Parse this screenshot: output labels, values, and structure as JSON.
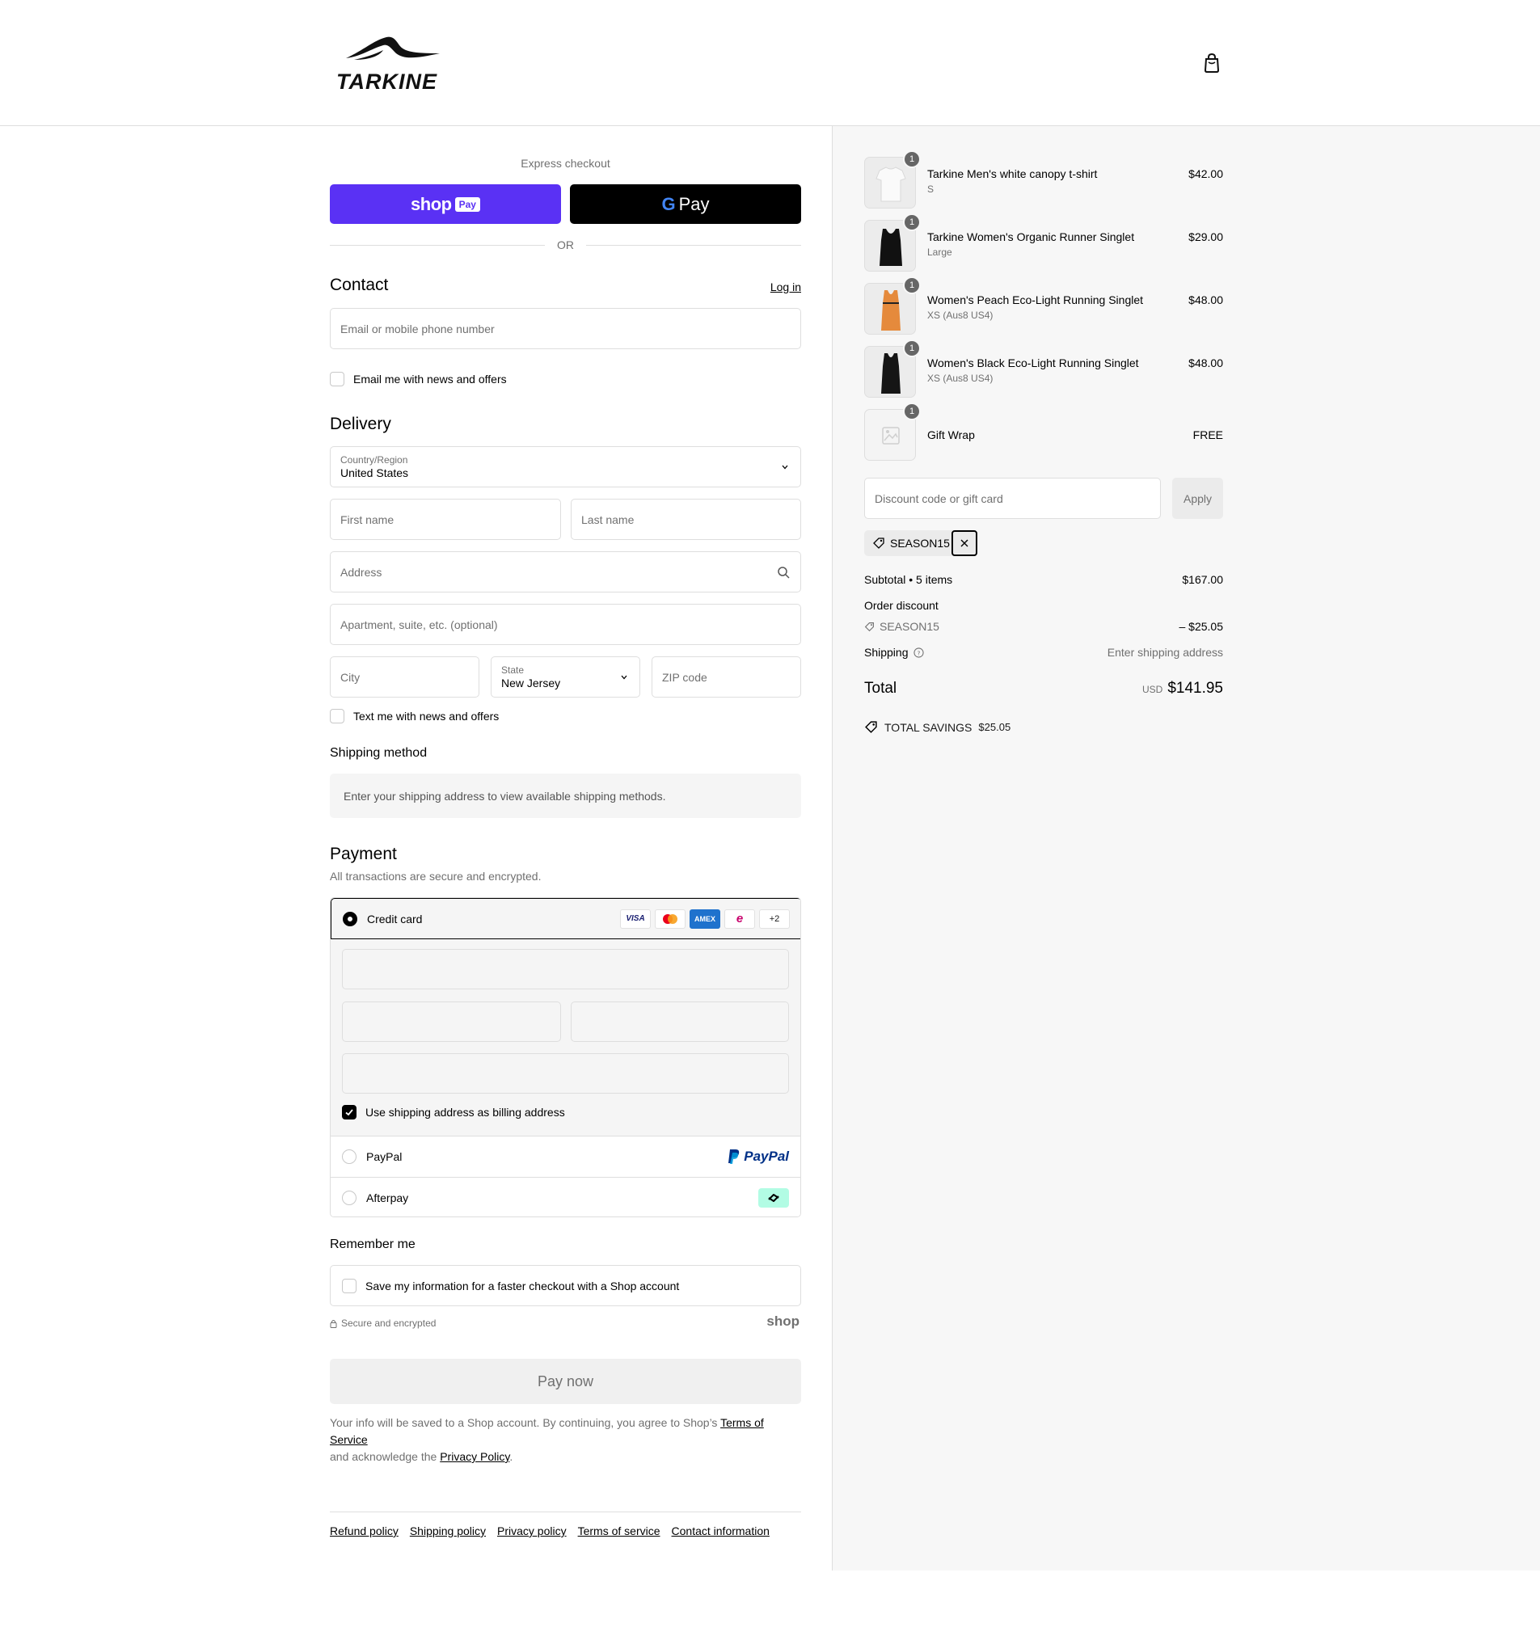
{
  "brand": {
    "name": "TARKINE"
  },
  "header": {
    "cart_icon": "shopping-bag-icon"
  },
  "express": {
    "title": "Express checkout",
    "shop_pay": {
      "word": "shop",
      "chip": "Pay"
    },
    "gpay": {
      "letter": "G",
      "word": "Pay"
    },
    "or": "OR"
  },
  "contact": {
    "title": "Contact",
    "login": "Log in",
    "email_placeholder": "Email or mobile phone number",
    "news_label": "Email me with news and offers"
  },
  "delivery": {
    "title": "Delivery",
    "country_label": "Country/Region",
    "country_value": "United States",
    "first_name": "First name",
    "last_name": "Last name",
    "address": "Address",
    "apartment": "Apartment, suite, etc. (optional)",
    "city": "City",
    "state_label": "State",
    "state_value": "New Jersey",
    "zip": "ZIP code",
    "text_label": "Text me with news and offers"
  },
  "shipping_method": {
    "title": "Shipping method",
    "message": "Enter your shipping address to view available shipping methods."
  },
  "payment": {
    "title": "Payment",
    "subtitle": "All transactions are secure and encrypted.",
    "credit_card": "Credit card",
    "card_brands": [
      "VISA",
      "mastercard",
      "AMEX",
      "elopeo"
    ],
    "more_cards": "+2",
    "billing_label": "Use shipping address as billing address",
    "paypal": "PayPal",
    "paypal_logo": "PayPal",
    "afterpay": "Afterpay"
  },
  "remember": {
    "title": "Remember me",
    "save_label": "Save my information for a faster checkout with a Shop account",
    "secure": "Secure and encrypted",
    "shop_mark": "shop"
  },
  "pay_now": "Pay now",
  "legal": {
    "prefix": "Your info will be saved to a Shop account. By continuing, you agree to Shop’s ",
    "terms": "Terms of Service",
    "middle": "and acknowledge the ",
    "privacy": "Privacy Policy",
    "suffix": "."
  },
  "footer": {
    "links": [
      "Refund policy",
      "Shipping policy",
      "Privacy policy",
      "Terms of service",
      "Contact information"
    ]
  },
  "order": {
    "items": [
      {
        "qty": "1",
        "name": "Tarkine Men's white canopy t-shirt",
        "variant": "S",
        "price": "$42.00",
        "color": "#f2f2f2"
      },
      {
        "qty": "1",
        "name": "Tarkine Women's Organic Runner Singlet",
        "variant": "Large",
        "price": "$29.00",
        "color": "#111111"
      },
      {
        "qty": "1",
        "name": "Women's Peach Eco-Light Running Singlet",
        "variant": "XS (Aus8 US4)",
        "price": "$48.00",
        "color": "#e58a3c"
      },
      {
        "qty": "1",
        "name": "Women's Black Eco-Light Running Singlet",
        "variant": "XS (Aus8 US4)",
        "price": "$48.00",
        "color": "#151515"
      },
      {
        "qty": "1",
        "name": "Gift Wrap",
        "variant": "",
        "price": "FREE",
        "color": "#f4f4f4"
      }
    ],
    "discount_placeholder": "Discount code or gift card",
    "apply": "Apply",
    "applied_code": "SEASON15",
    "subtotal_label": "Subtotal • 5 items",
    "subtotal_value": "$167.00",
    "order_discount_label": "Order discount",
    "discount_code": "SEASON15",
    "discount_value": "– $25.05",
    "shipping_label": "Shipping",
    "shipping_value": "Enter shipping address",
    "total_label": "Total",
    "currency": "USD",
    "total_value": "$141.95",
    "savings_label": "TOTAL SAVINGS",
    "savings_value": "$25.05"
  }
}
